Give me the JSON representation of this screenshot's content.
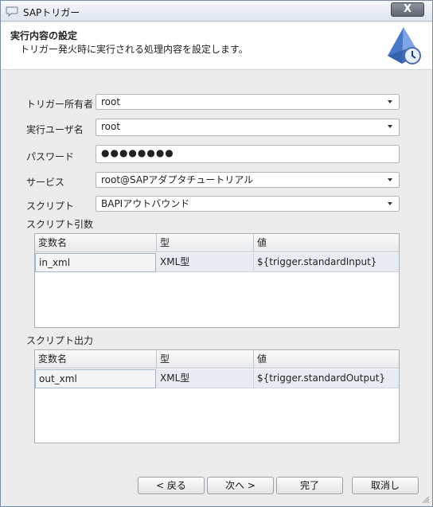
{
  "window": {
    "title": "SAPトリガー",
    "close": "X"
  },
  "header": {
    "title": "実行内容の設定",
    "description": "トリガー発火時に実行される処理内容を設定します。"
  },
  "form": {
    "owner_label": "トリガー所有者",
    "owner_value": "root",
    "exec_user_label": "実行ユーザ名",
    "exec_user_value": "root",
    "password_label": "パスワード",
    "password_value": "●●●●●●●●",
    "service_label": "サービス",
    "service_value": "root@SAPアダプタチュートリアル",
    "script_label": "スクリプト",
    "script_value": "BAPIアウトバウンド"
  },
  "script_args": {
    "label": "スクリプト引数",
    "columns": [
      "変数名",
      "型",
      "値"
    ],
    "rows": [
      [
        "in_xml",
        "XML型",
        "${trigger.standardInput}"
      ]
    ]
  },
  "script_output": {
    "label": "スクリプト出力",
    "columns": [
      "変数名",
      "型",
      "値"
    ],
    "rows": [
      [
        "out_xml",
        "XML型",
        "${trigger.standardOutput}"
      ]
    ]
  },
  "buttons": {
    "back": "< 戻る",
    "next": "次へ >",
    "finish": "完了",
    "cancel": "取消し"
  }
}
